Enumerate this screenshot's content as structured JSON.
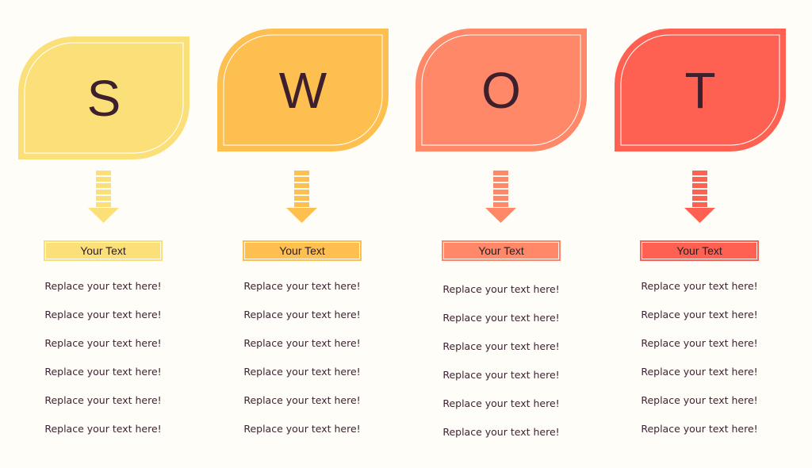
{
  "diagram": {
    "type": "swot",
    "columns": [
      {
        "letter": "S",
        "color": "#fbe07a",
        "header_label": "Your Text",
        "items": [
          "Replace your text here!",
          "Replace your text here!",
          "Replace your text here!",
          "Replace your text here!",
          "Replace your text here!",
          "Replace your text here!"
        ]
      },
      {
        "letter": "W",
        "color": "#fdbf4f",
        "header_label": "Your Text",
        "items": [
          "Replace your text here!",
          "Replace your text here!",
          "Replace your text here!",
          "Replace your text here!",
          "Replace your text here!",
          "Replace your text here!"
        ]
      },
      {
        "letter": "O",
        "color": "#fe8868",
        "header_label": "Your Text",
        "items": [
          "Replace your text here!",
          "Replace your text here!",
          "Replace your text here!",
          "Replace your text here!",
          "Replace your text here!",
          "Replace your text here!"
        ]
      },
      {
        "letter": "T",
        "color": "#fe6151",
        "header_label": "Your Text",
        "items": [
          "Replace your text here!",
          "Replace your text here!",
          "Replace your text here!",
          "Replace your text here!",
          "Replace your text here!",
          "Replace your text here!"
        ]
      }
    ]
  }
}
